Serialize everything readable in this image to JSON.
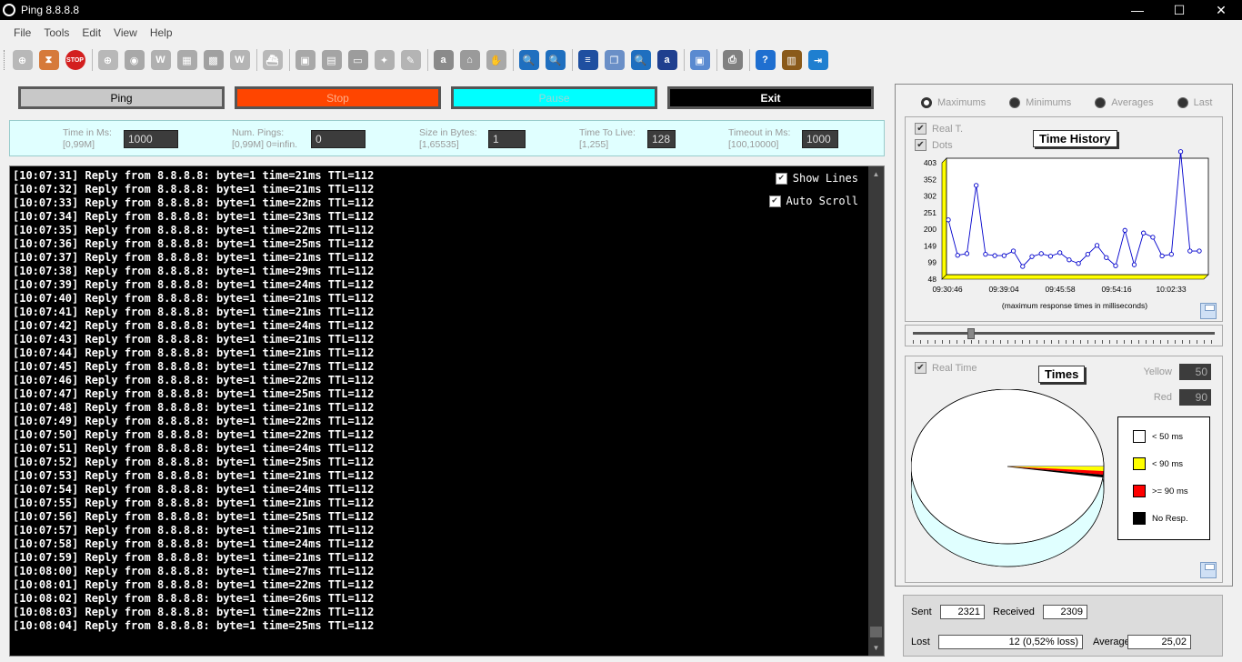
{
  "window": {
    "title": "Ping 8.8.8.8"
  },
  "menu": [
    "File",
    "Tools",
    "Edit",
    "View",
    "Help"
  ],
  "toolbar_icons": [
    {
      "name": "target-icon",
      "color": "#b8b8b8",
      "glyph": "⊕"
    },
    {
      "name": "hourglass-icon",
      "color": "#d67a3a",
      "glyph": "⧗"
    },
    {
      "name": "stop-icon",
      "color": "#d31f1f",
      "glyph": "STOP"
    },
    {
      "name": "sep"
    },
    {
      "name": "crosshair-icon",
      "color": "#b8b8b8",
      "glyph": "⊕"
    },
    {
      "name": "radar-icon",
      "color": "#a8a8a8",
      "glyph": "◉"
    },
    {
      "name": "www-icon",
      "color": "#b0b0b0",
      "glyph": "W"
    },
    {
      "name": "network-icon",
      "color": "#aaaaaa",
      "glyph": "▦"
    },
    {
      "name": "grid-icon",
      "color": "#a0a0a0",
      "glyph": "▩"
    },
    {
      "name": "wm-icon",
      "color": "#b4b4b4",
      "glyph": "W"
    },
    {
      "name": "sep"
    },
    {
      "name": "ship-icon",
      "color": "#b8b8b8",
      "glyph": "⛴"
    },
    {
      "name": "sep"
    },
    {
      "name": "computers-icon",
      "color": "#a8a8a8",
      "glyph": "▣"
    },
    {
      "name": "picture-icon",
      "color": "#a4a4a4",
      "glyph": "▤"
    },
    {
      "name": "monitor-icon",
      "color": "#9c9c9c",
      "glyph": "▭"
    },
    {
      "name": "satellite-icon",
      "color": "#b0b0b0",
      "glyph": "✦"
    },
    {
      "name": "pipette-icon",
      "color": "#b4b4b4",
      "glyph": "✎"
    },
    {
      "name": "sep"
    },
    {
      "name": "at-icon",
      "color": "#8a8a8a",
      "glyph": "a"
    },
    {
      "name": "bank-icon",
      "color": "#9a9a9a",
      "glyph": "⌂"
    },
    {
      "name": "hand-icon",
      "color": "#a8a8a8",
      "glyph": "✋"
    },
    {
      "name": "sep"
    },
    {
      "name": "zoom-in-icon",
      "color": "#1f6fbf",
      "glyph": "🔍"
    },
    {
      "name": "zoom-out-icon",
      "color": "#1f6fbf",
      "glyph": "🔍"
    },
    {
      "name": "sep"
    },
    {
      "name": "list-icon",
      "color": "#1f4fa0",
      "glyph": "≡"
    },
    {
      "name": "copy-icon",
      "color": "#6a8fc7",
      "glyph": "❐"
    },
    {
      "name": "find-icon",
      "color": "#1f6fbf",
      "glyph": "🔍"
    },
    {
      "name": "font-icon",
      "color": "#1f3f8f",
      "glyph": "a"
    },
    {
      "name": "sep"
    },
    {
      "name": "save-icon",
      "color": "#5a8ad0",
      "glyph": "▣"
    },
    {
      "name": "sep"
    },
    {
      "name": "printer-icon",
      "color": "#808080",
      "glyph": "⎙"
    },
    {
      "name": "sep"
    },
    {
      "name": "help-icon",
      "color": "#1f6fd0",
      "glyph": "?"
    },
    {
      "name": "info-icon",
      "color": "#8a5a1a",
      "glyph": "▥"
    },
    {
      "name": "exit-door-icon",
      "color": "#1f7fd0",
      "glyph": "⇥"
    }
  ],
  "buttons": {
    "ping": "Ping",
    "stop": "Stop",
    "pause": "Pause",
    "exit": "Exit"
  },
  "params": [
    {
      "label1": "Time in Ms:",
      "label2": "[0,99M]",
      "value": "1000"
    },
    {
      "label1": "Num. Pings:",
      "label2": "[0,99M] 0=infin.",
      "value": "0"
    },
    {
      "label1": "Size in Bytes:",
      "label2": "[1,65535]",
      "value": "1"
    },
    {
      "label1": "Time To Live:",
      "label2": "[1,255]",
      "value": "128"
    },
    {
      "label1": "Timeout in Ms:",
      "label2": "[100,10000]",
      "value": "1000"
    }
  ],
  "console": {
    "show_lines": "Show Lines",
    "auto_scroll": "Auto Scroll",
    "lines": [
      "[10:07:31] Reply from 8.8.8.8: byte=1 time=21ms TTL=112",
      "[10:07:32] Reply from 8.8.8.8: byte=1 time=21ms TTL=112",
      "[10:07:33] Reply from 8.8.8.8: byte=1 time=22ms TTL=112",
      "[10:07:34] Reply from 8.8.8.8: byte=1 time=23ms TTL=112",
      "[10:07:35] Reply from 8.8.8.8: byte=1 time=22ms TTL=112",
      "[10:07:36] Reply from 8.8.8.8: byte=1 time=25ms TTL=112",
      "[10:07:37] Reply from 8.8.8.8: byte=1 time=21ms TTL=112",
      "[10:07:38] Reply from 8.8.8.8: byte=1 time=29ms TTL=112",
      "[10:07:39] Reply from 8.8.8.8: byte=1 time=24ms TTL=112",
      "[10:07:40] Reply from 8.8.8.8: byte=1 time=21ms TTL=112",
      "[10:07:41] Reply from 8.8.8.8: byte=1 time=21ms TTL=112",
      "[10:07:42] Reply from 8.8.8.8: byte=1 time=24ms TTL=112",
      "[10:07:43] Reply from 8.8.8.8: byte=1 time=21ms TTL=112",
      "[10:07:44] Reply from 8.8.8.8: byte=1 time=21ms TTL=112",
      "[10:07:45] Reply from 8.8.8.8: byte=1 time=27ms TTL=112",
      "[10:07:46] Reply from 8.8.8.8: byte=1 time=22ms TTL=112",
      "[10:07:47] Reply from 8.8.8.8: byte=1 time=25ms TTL=112",
      "[10:07:48] Reply from 8.8.8.8: byte=1 time=21ms TTL=112",
      "[10:07:49] Reply from 8.8.8.8: byte=1 time=22ms TTL=112",
      "[10:07:50] Reply from 8.8.8.8: byte=1 time=22ms TTL=112",
      "[10:07:51] Reply from 8.8.8.8: byte=1 time=24ms TTL=112",
      "[10:07:52] Reply from 8.8.8.8: byte=1 time=25ms TTL=112",
      "[10:07:53] Reply from 8.8.8.8: byte=1 time=21ms TTL=112",
      "[10:07:54] Reply from 8.8.8.8: byte=1 time=24ms TTL=112",
      "[10:07:55] Reply from 8.8.8.8: byte=1 time=21ms TTL=112",
      "[10:07:56] Reply from 8.8.8.8: byte=1 time=25ms TTL=112",
      "[10:07:57] Reply from 8.8.8.8: byte=1 time=21ms TTL=112",
      "[10:07:58] Reply from 8.8.8.8: byte=1 time=24ms TTL=112",
      "[10:07:59] Reply from 8.8.8.8: byte=1 time=21ms TTL=112",
      "[10:08:00] Reply from 8.8.8.8: byte=1 time=27ms TTL=112",
      "[10:08:01] Reply from 8.8.8.8: byte=1 time=22ms TTL=112",
      "[10:08:02] Reply from 8.8.8.8: byte=1 time=26ms TTL=112",
      "[10:08:03] Reply from 8.8.8.8: byte=1 time=22ms TTL=112",
      "[10:08:04] Reply from 8.8.8.8: byte=1 time=25ms TTL=112"
    ]
  },
  "history": {
    "radios": [
      {
        "label": "Maximums",
        "selected": true
      },
      {
        "label": "Minimums",
        "selected": false
      },
      {
        "label": "Averages",
        "selected": false
      },
      {
        "label": "Last",
        "selected": false
      }
    ],
    "opt_real": "Real T.",
    "opt_dots": "Dots",
    "title": "Time History"
  },
  "chart_data": [
    {
      "type": "line",
      "title": "Time History",
      "subtitle": "(maximum response times in milliseconds)",
      "yticks": [
        "48",
        "99",
        "149",
        "200",
        "251",
        "302",
        "352",
        "403"
      ],
      "ylim": [
        48,
        403
      ],
      "xticks": [
        "09:30:46",
        "09:39:04",
        "09:45:58",
        "09:54:16",
        "10:02:33"
      ],
      "values": [
        215,
        107,
        112,
        320,
        110,
        106,
        106,
        120,
        73,
        103,
        112,
        104,
        115,
        93,
        82,
        110,
        137,
        100,
        75,
        183,
        78,
        175,
        162,
        105,
        110,
        423,
        120,
        120
      ],
      "colors": {
        "line": "#0000cc",
        "fill": "#ffff00",
        "plot": "#ffffff"
      }
    },
    {
      "type": "pie",
      "title": "Times",
      "categories": [
        "< 50 ms",
        "< 90 ms",
        ">= 90 ms",
        "No Resp."
      ],
      "values": [
        2270,
        22,
        17,
        12
      ],
      "colors": [
        "#ffffff",
        "#ffff00",
        "#ff0000",
        "#000000"
      ]
    }
  ],
  "times": {
    "real_time": "Real Time",
    "title": "Times",
    "yellow_label": "Yellow",
    "yellow_value": "50",
    "red_label": "Red",
    "red_value": "90"
  },
  "stats": {
    "sent_label": "Sent",
    "sent": "2321",
    "received_label": "Received",
    "received": "2309",
    "lost_label": "Lost",
    "lost": "12 (0,52% loss)",
    "average_label": "Average",
    "average": "25,02"
  }
}
